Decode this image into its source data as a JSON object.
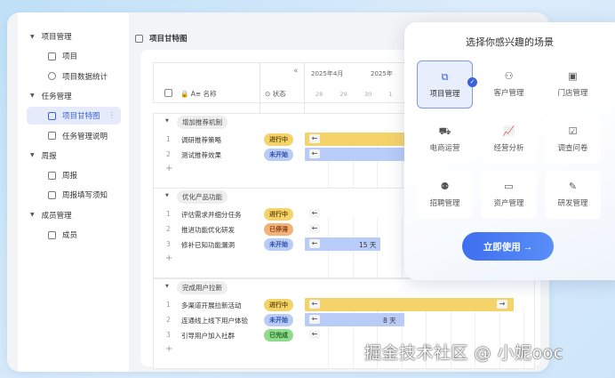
{
  "sidebar": {
    "items": [
      {
        "type": "group",
        "label": "项目管理"
      },
      {
        "type": "item",
        "label": "项目",
        "icon": "table-icon"
      },
      {
        "type": "item",
        "label": "项目数据统计",
        "icon": "clock-icon"
      },
      {
        "type": "group",
        "label": "任务管理"
      },
      {
        "type": "item",
        "label": "项目甘特图",
        "icon": "gantt-icon",
        "active": true
      },
      {
        "type": "item",
        "label": "任务管理说明",
        "icon": "doc-icon"
      },
      {
        "type": "group",
        "label": "周报"
      },
      {
        "type": "item",
        "label": "周报",
        "icon": "table-icon"
      },
      {
        "type": "item",
        "label": "周报填写须知",
        "icon": "doc-icon"
      },
      {
        "type": "group",
        "label": "成员管理"
      },
      {
        "type": "item",
        "label": "成员",
        "icon": "table-icon"
      }
    ]
  },
  "page": {
    "title": "项目甘特图"
  },
  "table": {
    "col_name": "名称",
    "col_status": "状态",
    "collapse": "«",
    "months": [
      "2025年4月",
      "2025年"
    ],
    "days": [
      "28",
      "29",
      "30",
      "1"
    ],
    "add": "+"
  },
  "groups": [
    {
      "name": "增加推荐机制",
      "tasks": [
        {
          "n": "1",
          "name": "调研推荐策略",
          "status": "进行中",
          "kind": "doing",
          "bar_days": null,
          "bar_end": "long"
        },
        {
          "n": "2",
          "name": "测试推荐效果",
          "status": "未开始",
          "kind": "todo",
          "bar_days": null,
          "bar_end": "long"
        }
      ]
    },
    {
      "name": "优化产品功能",
      "tasks": [
        {
          "n": "1",
          "name": "评估需求并细分任务",
          "status": "进行中",
          "kind": "doing",
          "bar_days": null,
          "bar_end": "none"
        },
        {
          "n": "2",
          "name": "推进功能优化研发",
          "status": "已停滞",
          "kind": "stalled",
          "bar_days": null,
          "bar_end": "none"
        },
        {
          "n": "3",
          "name": "修补已知功能漏洞",
          "status": "未开始",
          "kind": "todo",
          "bar_days": "15 天",
          "bar_end": "mid"
        }
      ]
    },
    {
      "name": "完成用户拉新",
      "tasks": [
        {
          "n": "1",
          "name": "多渠道开展拉新活动",
          "status": "进行中",
          "kind": "doing",
          "bar_days": null,
          "bar_end": "full"
        },
        {
          "n": "2",
          "name": "连通线上线下用户体验",
          "status": "未开始",
          "kind": "todo",
          "bar_days": "8 天",
          "bar_end": "short"
        },
        {
          "n": "3",
          "name": "引导用户加入社群",
          "status": "已完成",
          "kind": "done",
          "bar_days": null,
          "bar_end": "none"
        }
      ]
    }
  ],
  "colors": {
    "doing": "#f5d36b",
    "todo": "#b9cbf7",
    "stalled": "#f3b27a",
    "done": "#8fdc8f",
    "accent": "#3a62d8"
  },
  "popup": {
    "title": "选择你感兴趣的场景",
    "options": [
      {
        "label": "项目管理",
        "icon": "gantt-icon",
        "glyph": "⧉",
        "selected": true
      },
      {
        "label": "客户管理",
        "icon": "customer-icon",
        "glyph": "⚇"
      },
      {
        "label": "门店管理",
        "icon": "store-icon",
        "glyph": "▣"
      },
      {
        "label": "电商运营",
        "icon": "cart-icon",
        "glyph": "⛟"
      },
      {
        "label": "经营分析",
        "icon": "chart-icon",
        "glyph": "📈"
      },
      {
        "label": "调查问卷",
        "icon": "survey-icon",
        "glyph": "☑"
      },
      {
        "label": "招聘管理",
        "icon": "people-icon",
        "glyph": "⚉"
      },
      {
        "label": "资产管理",
        "icon": "asset-icon",
        "glyph": "▭"
      },
      {
        "label": "研发管理",
        "icon": "pen-icon",
        "glyph": "✎"
      }
    ],
    "cta": "立即使用 →"
  },
  "watermark": "掘金技术社区 @ 小妮ooc"
}
